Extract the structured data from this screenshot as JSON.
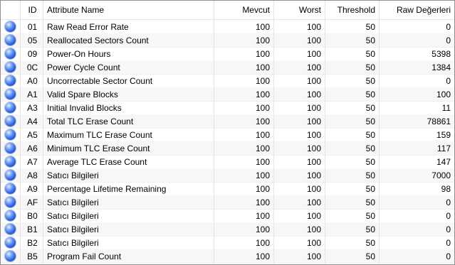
{
  "columns": {
    "id": "ID",
    "name": "Attribute Name",
    "current": "Mevcut",
    "worst": "Worst",
    "threshold": "Threshold",
    "raw": "Raw Değerleri"
  },
  "status_icon": "status-good-orb-icon",
  "status_color": "#2a5ee0",
  "rows": [
    {
      "id": "01",
      "name": "Raw Read Error Rate",
      "current": "100",
      "worst": "100",
      "threshold": "50",
      "raw": "0"
    },
    {
      "id": "05",
      "name": "Reallocated Sectors Count",
      "current": "100",
      "worst": "100",
      "threshold": "50",
      "raw": "0"
    },
    {
      "id": "09",
      "name": "Power-On Hours",
      "current": "100",
      "worst": "100",
      "threshold": "50",
      "raw": "5398"
    },
    {
      "id": "0C",
      "name": "Power Cycle Count",
      "current": "100",
      "worst": "100",
      "threshold": "50",
      "raw": "1384"
    },
    {
      "id": "A0",
      "name": "Uncorrectable Sector Count",
      "current": "100",
      "worst": "100",
      "threshold": "50",
      "raw": "0"
    },
    {
      "id": "A1",
      "name": "Valid Spare Blocks",
      "current": "100",
      "worst": "100",
      "threshold": "50",
      "raw": "100"
    },
    {
      "id": "A3",
      "name": "Initial Invalid Blocks",
      "current": "100",
      "worst": "100",
      "threshold": "50",
      "raw": "11"
    },
    {
      "id": "A4",
      "name": "Total TLC Erase Count",
      "current": "100",
      "worst": "100",
      "threshold": "50",
      "raw": "78861"
    },
    {
      "id": "A5",
      "name": "Maximum TLC Erase Count",
      "current": "100",
      "worst": "100",
      "threshold": "50",
      "raw": "159"
    },
    {
      "id": "A6",
      "name": "Minimum TLC Erase Count",
      "current": "100",
      "worst": "100",
      "threshold": "50",
      "raw": "117"
    },
    {
      "id": "A7",
      "name": "Average TLC Erase Count",
      "current": "100",
      "worst": "100",
      "threshold": "50",
      "raw": "147"
    },
    {
      "id": "A8",
      "name": "Satıcı Bilgileri",
      "current": "100",
      "worst": "100",
      "threshold": "50",
      "raw": "7000"
    },
    {
      "id": "A9",
      "name": "Percentage Lifetime Remaining",
      "current": "100",
      "worst": "100",
      "threshold": "50",
      "raw": "98"
    },
    {
      "id": "AF",
      "name": "Satıcı Bilgileri",
      "current": "100",
      "worst": "100",
      "threshold": "50",
      "raw": "0"
    },
    {
      "id": "B0",
      "name": "Satıcı Bilgileri",
      "current": "100",
      "worst": "100",
      "threshold": "50",
      "raw": "0"
    },
    {
      "id": "B1",
      "name": "Satıcı Bilgileri",
      "current": "100",
      "worst": "100",
      "threshold": "50",
      "raw": "0"
    },
    {
      "id": "B2",
      "name": "Satıcı Bilgileri",
      "current": "100",
      "worst": "100",
      "threshold": "50",
      "raw": "0"
    },
    {
      "id": "B5",
      "name": "Program Fail Count",
      "current": "100",
      "worst": "100",
      "threshold": "50",
      "raw": "0"
    }
  ]
}
